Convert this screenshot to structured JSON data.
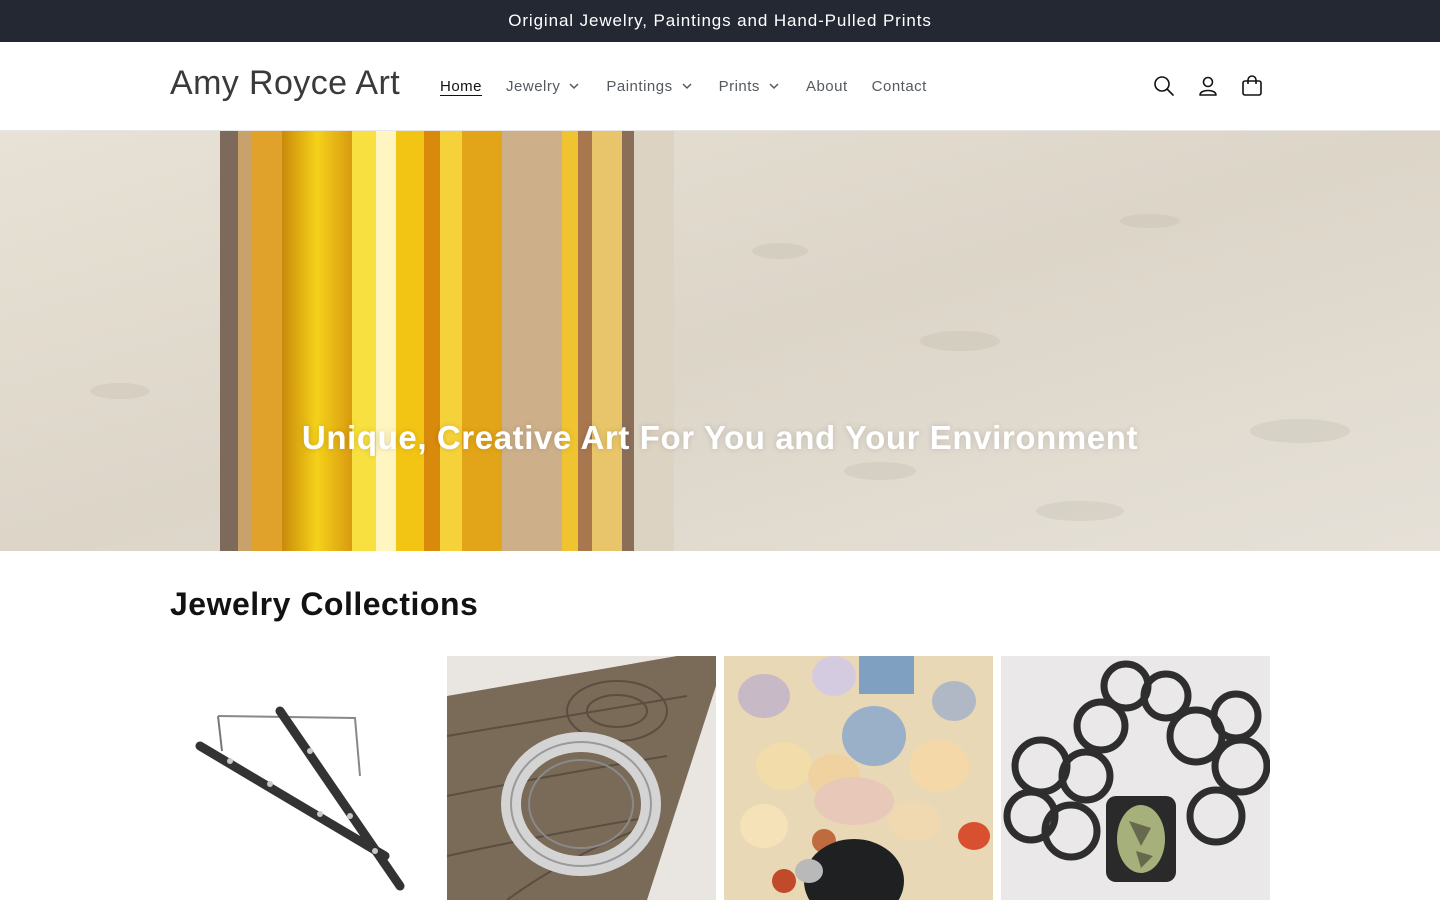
{
  "announcement": {
    "text": "Original Jewelry, Paintings and Hand-Pulled Prints"
  },
  "header": {
    "logo": "Amy Royce Art",
    "nav": [
      {
        "label": "Home",
        "active": true,
        "dropdown": false
      },
      {
        "label": "Jewelry",
        "active": false,
        "dropdown": true
      },
      {
        "label": "Paintings",
        "active": false,
        "dropdown": true
      },
      {
        "label": "Prints",
        "active": false,
        "dropdown": true
      },
      {
        "label": "About",
        "active": false,
        "dropdown": false
      },
      {
        "label": "Contact",
        "active": false,
        "dropdown": false
      }
    ],
    "icons": [
      "search-icon",
      "account-icon",
      "cart-icon"
    ]
  },
  "hero": {
    "heading": "Unique, Creative Art For You and Your Environment"
  },
  "collections": {
    "title": "Jewelry Collections",
    "cards": [
      {
        "image": "silver-bar-earrings-image"
      },
      {
        "image": "hammered-silver-ring-image"
      },
      {
        "image": "gemstone-beads-image"
      },
      {
        "image": "chain-link-turquoise-bracelet-image"
      }
    ]
  },
  "colors": {
    "announcement_bg": "#242833",
    "text_dark": "#121212",
    "nav_text": "#555a60"
  }
}
